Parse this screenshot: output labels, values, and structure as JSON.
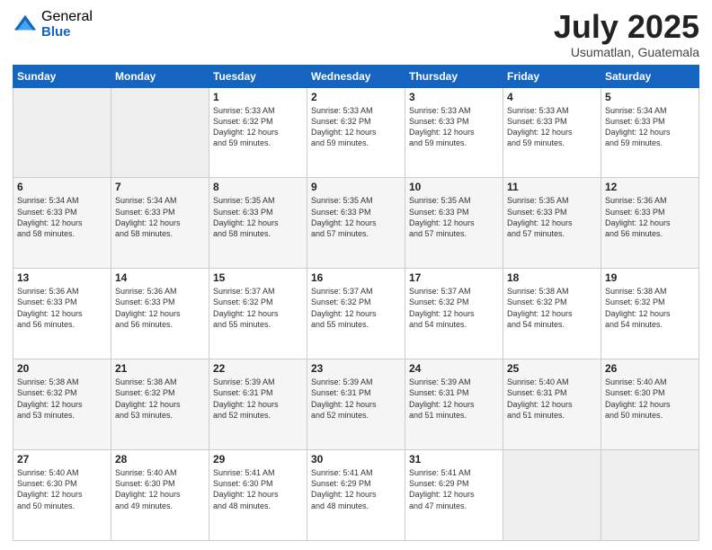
{
  "logo": {
    "general": "General",
    "blue": "Blue"
  },
  "title": "July 2025",
  "location": "Usumatlan, Guatemala",
  "days_header": [
    "Sunday",
    "Monday",
    "Tuesday",
    "Wednesday",
    "Thursday",
    "Friday",
    "Saturday"
  ],
  "weeks": [
    [
      {
        "num": "",
        "info": ""
      },
      {
        "num": "",
        "info": ""
      },
      {
        "num": "1",
        "info": "Sunrise: 5:33 AM\nSunset: 6:32 PM\nDaylight: 12 hours\nand 59 minutes."
      },
      {
        "num": "2",
        "info": "Sunrise: 5:33 AM\nSunset: 6:32 PM\nDaylight: 12 hours\nand 59 minutes."
      },
      {
        "num": "3",
        "info": "Sunrise: 5:33 AM\nSunset: 6:33 PM\nDaylight: 12 hours\nand 59 minutes."
      },
      {
        "num": "4",
        "info": "Sunrise: 5:33 AM\nSunset: 6:33 PM\nDaylight: 12 hours\nand 59 minutes."
      },
      {
        "num": "5",
        "info": "Sunrise: 5:34 AM\nSunset: 6:33 PM\nDaylight: 12 hours\nand 59 minutes."
      }
    ],
    [
      {
        "num": "6",
        "info": "Sunrise: 5:34 AM\nSunset: 6:33 PM\nDaylight: 12 hours\nand 58 minutes."
      },
      {
        "num": "7",
        "info": "Sunrise: 5:34 AM\nSunset: 6:33 PM\nDaylight: 12 hours\nand 58 minutes."
      },
      {
        "num": "8",
        "info": "Sunrise: 5:35 AM\nSunset: 6:33 PM\nDaylight: 12 hours\nand 58 minutes."
      },
      {
        "num": "9",
        "info": "Sunrise: 5:35 AM\nSunset: 6:33 PM\nDaylight: 12 hours\nand 57 minutes."
      },
      {
        "num": "10",
        "info": "Sunrise: 5:35 AM\nSunset: 6:33 PM\nDaylight: 12 hours\nand 57 minutes."
      },
      {
        "num": "11",
        "info": "Sunrise: 5:35 AM\nSunset: 6:33 PM\nDaylight: 12 hours\nand 57 minutes."
      },
      {
        "num": "12",
        "info": "Sunrise: 5:36 AM\nSunset: 6:33 PM\nDaylight: 12 hours\nand 56 minutes."
      }
    ],
    [
      {
        "num": "13",
        "info": "Sunrise: 5:36 AM\nSunset: 6:33 PM\nDaylight: 12 hours\nand 56 minutes."
      },
      {
        "num": "14",
        "info": "Sunrise: 5:36 AM\nSunset: 6:33 PM\nDaylight: 12 hours\nand 56 minutes."
      },
      {
        "num": "15",
        "info": "Sunrise: 5:37 AM\nSunset: 6:32 PM\nDaylight: 12 hours\nand 55 minutes."
      },
      {
        "num": "16",
        "info": "Sunrise: 5:37 AM\nSunset: 6:32 PM\nDaylight: 12 hours\nand 55 minutes."
      },
      {
        "num": "17",
        "info": "Sunrise: 5:37 AM\nSunset: 6:32 PM\nDaylight: 12 hours\nand 54 minutes."
      },
      {
        "num": "18",
        "info": "Sunrise: 5:38 AM\nSunset: 6:32 PM\nDaylight: 12 hours\nand 54 minutes."
      },
      {
        "num": "19",
        "info": "Sunrise: 5:38 AM\nSunset: 6:32 PM\nDaylight: 12 hours\nand 54 minutes."
      }
    ],
    [
      {
        "num": "20",
        "info": "Sunrise: 5:38 AM\nSunset: 6:32 PM\nDaylight: 12 hours\nand 53 minutes."
      },
      {
        "num": "21",
        "info": "Sunrise: 5:38 AM\nSunset: 6:32 PM\nDaylight: 12 hours\nand 53 minutes."
      },
      {
        "num": "22",
        "info": "Sunrise: 5:39 AM\nSunset: 6:31 PM\nDaylight: 12 hours\nand 52 minutes."
      },
      {
        "num": "23",
        "info": "Sunrise: 5:39 AM\nSunset: 6:31 PM\nDaylight: 12 hours\nand 52 minutes."
      },
      {
        "num": "24",
        "info": "Sunrise: 5:39 AM\nSunset: 6:31 PM\nDaylight: 12 hours\nand 51 minutes."
      },
      {
        "num": "25",
        "info": "Sunrise: 5:40 AM\nSunset: 6:31 PM\nDaylight: 12 hours\nand 51 minutes."
      },
      {
        "num": "26",
        "info": "Sunrise: 5:40 AM\nSunset: 6:30 PM\nDaylight: 12 hours\nand 50 minutes."
      }
    ],
    [
      {
        "num": "27",
        "info": "Sunrise: 5:40 AM\nSunset: 6:30 PM\nDaylight: 12 hours\nand 50 minutes."
      },
      {
        "num": "28",
        "info": "Sunrise: 5:40 AM\nSunset: 6:30 PM\nDaylight: 12 hours\nand 49 minutes."
      },
      {
        "num": "29",
        "info": "Sunrise: 5:41 AM\nSunset: 6:30 PM\nDaylight: 12 hours\nand 48 minutes."
      },
      {
        "num": "30",
        "info": "Sunrise: 5:41 AM\nSunset: 6:29 PM\nDaylight: 12 hours\nand 48 minutes."
      },
      {
        "num": "31",
        "info": "Sunrise: 5:41 AM\nSunset: 6:29 PM\nDaylight: 12 hours\nand 47 minutes."
      },
      {
        "num": "",
        "info": ""
      },
      {
        "num": "",
        "info": ""
      }
    ]
  ]
}
